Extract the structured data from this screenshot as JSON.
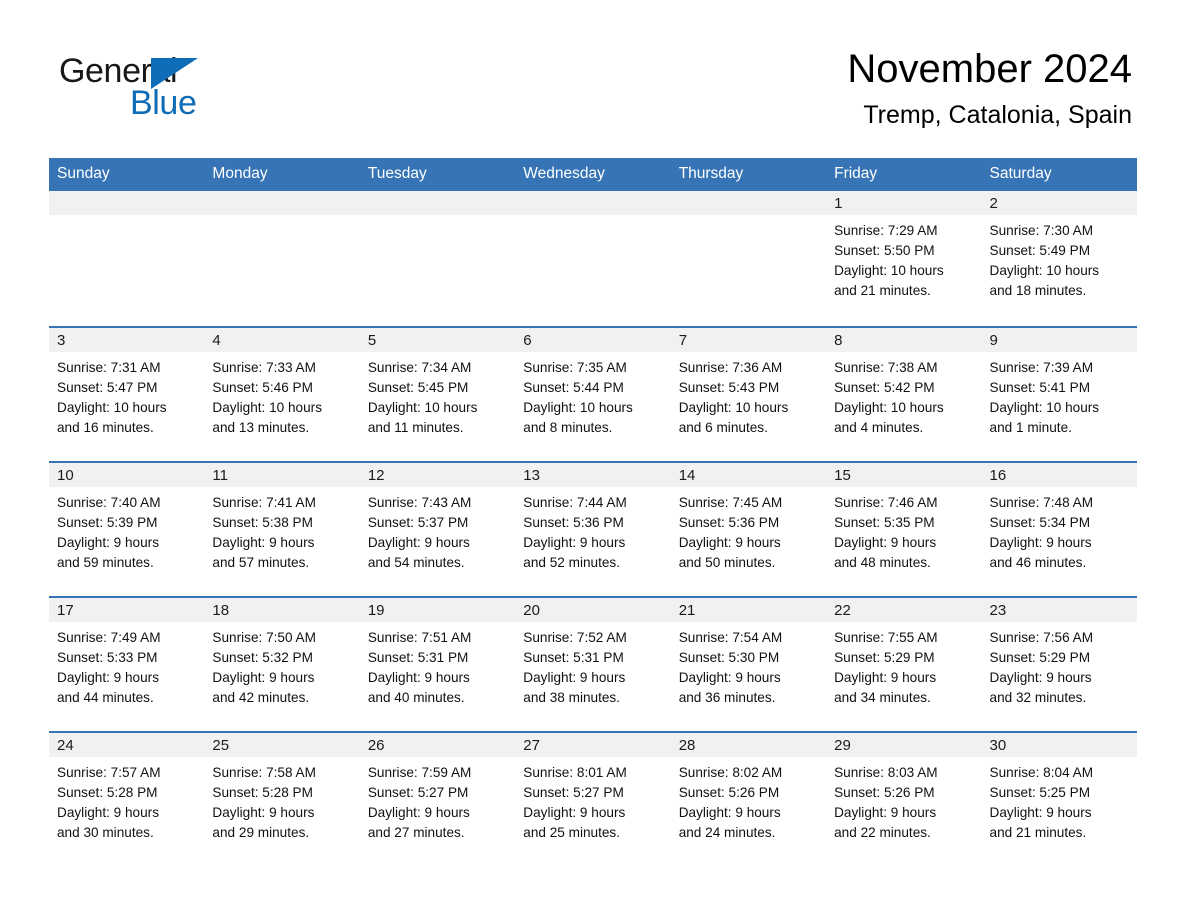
{
  "brand": {
    "name_part1": "General",
    "name_part2": "Blue",
    "flag_icon": "triangle-flag-icon",
    "accent_color": "#0F6CB6"
  },
  "header": {
    "month_title": "November 2024",
    "location": "Tremp, Catalonia, Spain"
  },
  "theme": {
    "header_blue": "#3674B5",
    "daynum_band": "#F1F1F1",
    "text": "#111111"
  },
  "weekday_headers": [
    "Sunday",
    "Monday",
    "Tuesday",
    "Wednesday",
    "Thursday",
    "Friday",
    "Saturday"
  ],
  "weeks": [
    {
      "days": [
        {
          "date": "",
          "blank": true,
          "sunrise": "",
          "sunset": "",
          "daylight_line1": "",
          "daylight_line2": ""
        },
        {
          "date": "",
          "blank": true,
          "sunrise": "",
          "sunset": "",
          "daylight_line1": "",
          "daylight_line2": ""
        },
        {
          "date": "",
          "blank": true,
          "sunrise": "",
          "sunset": "",
          "daylight_line1": "",
          "daylight_line2": ""
        },
        {
          "date": "",
          "blank": true,
          "sunrise": "",
          "sunset": "",
          "daylight_line1": "",
          "daylight_line2": ""
        },
        {
          "date": "",
          "blank": true,
          "sunrise": "",
          "sunset": "",
          "daylight_line1": "",
          "daylight_line2": ""
        },
        {
          "date": "1",
          "blank": false,
          "sunrise": "Sunrise: 7:29 AM",
          "sunset": "Sunset: 5:50 PM",
          "daylight_line1": "Daylight: 10 hours",
          "daylight_line2": "and 21 minutes."
        },
        {
          "date": "2",
          "blank": false,
          "sunrise": "Sunrise: 7:30 AM",
          "sunset": "Sunset: 5:49 PM",
          "daylight_line1": "Daylight: 10 hours",
          "daylight_line2": "and 18 minutes."
        }
      ]
    },
    {
      "days": [
        {
          "date": "3",
          "blank": false,
          "sunrise": "Sunrise: 7:31 AM",
          "sunset": "Sunset: 5:47 PM",
          "daylight_line1": "Daylight: 10 hours",
          "daylight_line2": "and 16 minutes."
        },
        {
          "date": "4",
          "blank": false,
          "sunrise": "Sunrise: 7:33 AM",
          "sunset": "Sunset: 5:46 PM",
          "daylight_line1": "Daylight: 10 hours",
          "daylight_line2": "and 13 minutes."
        },
        {
          "date": "5",
          "blank": false,
          "sunrise": "Sunrise: 7:34 AM",
          "sunset": "Sunset: 5:45 PM",
          "daylight_line1": "Daylight: 10 hours",
          "daylight_line2": "and 11 minutes."
        },
        {
          "date": "6",
          "blank": false,
          "sunrise": "Sunrise: 7:35 AM",
          "sunset": "Sunset: 5:44 PM",
          "daylight_line1": "Daylight: 10 hours",
          "daylight_line2": "and 8 minutes."
        },
        {
          "date": "7",
          "blank": false,
          "sunrise": "Sunrise: 7:36 AM",
          "sunset": "Sunset: 5:43 PM",
          "daylight_line1": "Daylight: 10 hours",
          "daylight_line2": "and 6 minutes."
        },
        {
          "date": "8",
          "blank": false,
          "sunrise": "Sunrise: 7:38 AM",
          "sunset": "Sunset: 5:42 PM",
          "daylight_line1": "Daylight: 10 hours",
          "daylight_line2": "and 4 minutes."
        },
        {
          "date": "9",
          "blank": false,
          "sunrise": "Sunrise: 7:39 AM",
          "sunset": "Sunset: 5:41 PM",
          "daylight_line1": "Daylight: 10 hours",
          "daylight_line2": "and 1 minute."
        }
      ]
    },
    {
      "days": [
        {
          "date": "10",
          "blank": false,
          "sunrise": "Sunrise: 7:40 AM",
          "sunset": "Sunset: 5:39 PM",
          "daylight_line1": "Daylight: 9 hours",
          "daylight_line2": "and 59 minutes."
        },
        {
          "date": "11",
          "blank": false,
          "sunrise": "Sunrise: 7:41 AM",
          "sunset": "Sunset: 5:38 PM",
          "daylight_line1": "Daylight: 9 hours",
          "daylight_line2": "and 57 minutes."
        },
        {
          "date": "12",
          "blank": false,
          "sunrise": "Sunrise: 7:43 AM",
          "sunset": "Sunset: 5:37 PM",
          "daylight_line1": "Daylight: 9 hours",
          "daylight_line2": "and 54 minutes."
        },
        {
          "date": "13",
          "blank": false,
          "sunrise": "Sunrise: 7:44 AM",
          "sunset": "Sunset: 5:36 PM",
          "daylight_line1": "Daylight: 9 hours",
          "daylight_line2": "and 52 minutes."
        },
        {
          "date": "14",
          "blank": false,
          "sunrise": "Sunrise: 7:45 AM",
          "sunset": "Sunset: 5:36 PM",
          "daylight_line1": "Daylight: 9 hours",
          "daylight_line2": "and 50 minutes."
        },
        {
          "date": "15",
          "blank": false,
          "sunrise": "Sunrise: 7:46 AM",
          "sunset": "Sunset: 5:35 PM",
          "daylight_line1": "Daylight: 9 hours",
          "daylight_line2": "and 48 minutes."
        },
        {
          "date": "16",
          "blank": false,
          "sunrise": "Sunrise: 7:48 AM",
          "sunset": "Sunset: 5:34 PM",
          "daylight_line1": "Daylight: 9 hours",
          "daylight_line2": "and 46 minutes."
        }
      ]
    },
    {
      "days": [
        {
          "date": "17",
          "blank": false,
          "sunrise": "Sunrise: 7:49 AM",
          "sunset": "Sunset: 5:33 PM",
          "daylight_line1": "Daylight: 9 hours",
          "daylight_line2": "and 44 minutes."
        },
        {
          "date": "18",
          "blank": false,
          "sunrise": "Sunrise: 7:50 AM",
          "sunset": "Sunset: 5:32 PM",
          "daylight_line1": "Daylight: 9 hours",
          "daylight_line2": "and 42 minutes."
        },
        {
          "date": "19",
          "blank": false,
          "sunrise": "Sunrise: 7:51 AM",
          "sunset": "Sunset: 5:31 PM",
          "daylight_line1": "Daylight: 9 hours",
          "daylight_line2": "and 40 minutes."
        },
        {
          "date": "20",
          "blank": false,
          "sunrise": "Sunrise: 7:52 AM",
          "sunset": "Sunset: 5:31 PM",
          "daylight_line1": "Daylight: 9 hours",
          "daylight_line2": "and 38 minutes."
        },
        {
          "date": "21",
          "blank": false,
          "sunrise": "Sunrise: 7:54 AM",
          "sunset": "Sunset: 5:30 PM",
          "daylight_line1": "Daylight: 9 hours",
          "daylight_line2": "and 36 minutes."
        },
        {
          "date": "22",
          "blank": false,
          "sunrise": "Sunrise: 7:55 AM",
          "sunset": "Sunset: 5:29 PM",
          "daylight_line1": "Daylight: 9 hours",
          "daylight_line2": "and 34 minutes."
        },
        {
          "date": "23",
          "blank": false,
          "sunrise": "Sunrise: 7:56 AM",
          "sunset": "Sunset: 5:29 PM",
          "daylight_line1": "Daylight: 9 hours",
          "daylight_line2": "and 32 minutes."
        }
      ]
    },
    {
      "days": [
        {
          "date": "24",
          "blank": false,
          "sunrise": "Sunrise: 7:57 AM",
          "sunset": "Sunset: 5:28 PM",
          "daylight_line1": "Daylight: 9 hours",
          "daylight_line2": "and 30 minutes."
        },
        {
          "date": "25",
          "blank": false,
          "sunrise": "Sunrise: 7:58 AM",
          "sunset": "Sunset: 5:28 PM",
          "daylight_line1": "Daylight: 9 hours",
          "daylight_line2": "and 29 minutes."
        },
        {
          "date": "26",
          "blank": false,
          "sunrise": "Sunrise: 7:59 AM",
          "sunset": "Sunset: 5:27 PM",
          "daylight_line1": "Daylight: 9 hours",
          "daylight_line2": "and 27 minutes."
        },
        {
          "date": "27",
          "blank": false,
          "sunrise": "Sunrise: 8:01 AM",
          "sunset": "Sunset: 5:27 PM",
          "daylight_line1": "Daylight: 9 hours",
          "daylight_line2": "and 25 minutes."
        },
        {
          "date": "28",
          "blank": false,
          "sunrise": "Sunrise: 8:02 AM",
          "sunset": "Sunset: 5:26 PM",
          "daylight_line1": "Daylight: 9 hours",
          "daylight_line2": "and 24 minutes."
        },
        {
          "date": "29",
          "blank": false,
          "sunrise": "Sunrise: 8:03 AM",
          "sunset": "Sunset: 5:26 PM",
          "daylight_line1": "Daylight: 9 hours",
          "daylight_line2": "and 22 minutes."
        },
        {
          "date": "30",
          "blank": false,
          "sunrise": "Sunrise: 8:04 AM",
          "sunset": "Sunset: 5:25 PM",
          "daylight_line1": "Daylight: 9 hours",
          "daylight_line2": "and 21 minutes."
        }
      ]
    }
  ]
}
